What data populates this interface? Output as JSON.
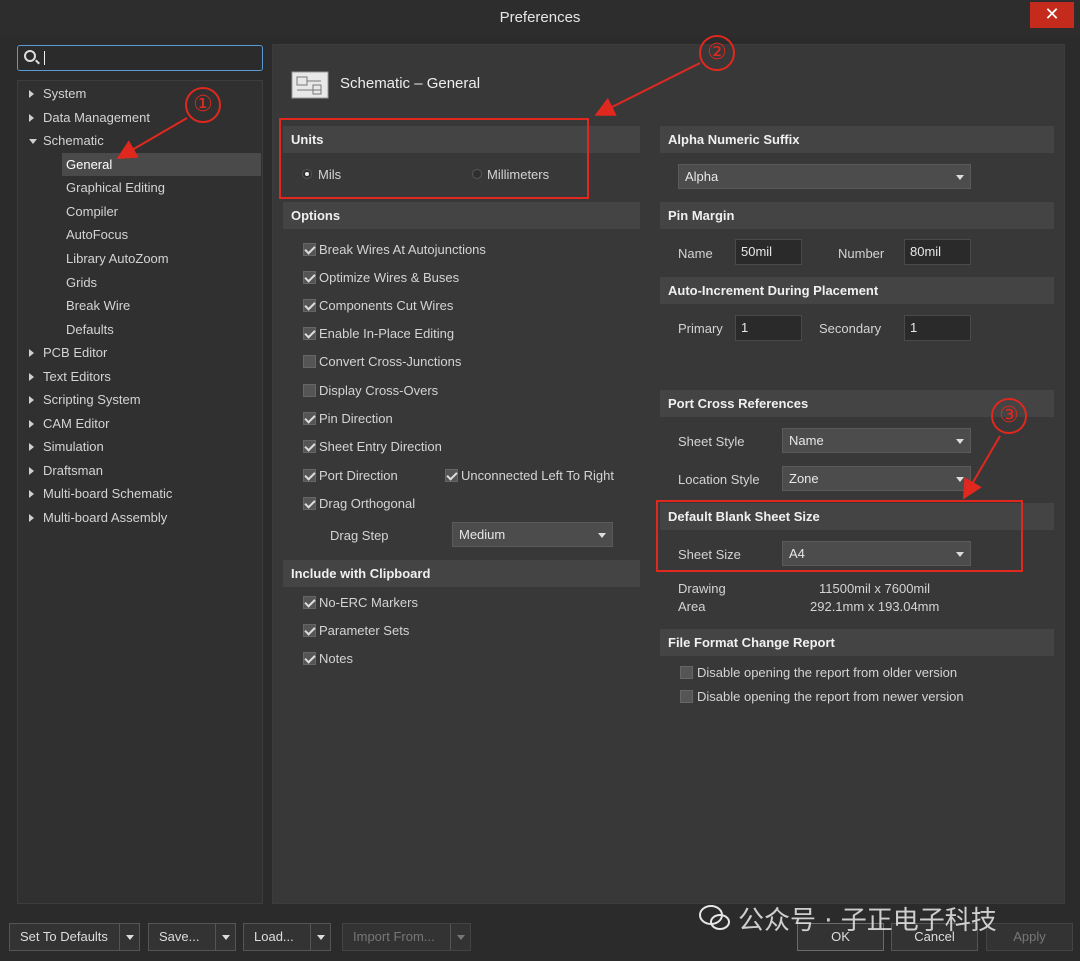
{
  "window": {
    "title": "Preferences",
    "close": "✕"
  },
  "search": {
    "placeholder": ""
  },
  "tree": [
    {
      "label": "System"
    },
    {
      "label": "Data Management"
    },
    {
      "label": "Schematic"
    },
    {
      "label": "General"
    },
    {
      "label": "Graphical Editing"
    },
    {
      "label": "Compiler"
    },
    {
      "label": "AutoFocus"
    },
    {
      "label": "Library AutoZoom"
    },
    {
      "label": "Grids"
    },
    {
      "label": "Break Wire"
    },
    {
      "label": "Defaults"
    },
    {
      "label": "PCB Editor"
    },
    {
      "label": "Text Editors"
    },
    {
      "label": "Scripting System"
    },
    {
      "label": "CAM Editor"
    },
    {
      "label": "Simulation"
    },
    {
      "label": "Draftsman"
    },
    {
      "label": "Multi-board Schematic"
    },
    {
      "label": "Multi-board Assembly"
    }
  ],
  "page": {
    "title": "Schematic – General"
  },
  "units": {
    "header": "Units",
    "mils": "Mils",
    "millimeters": "Millimeters"
  },
  "options": {
    "header": "Options",
    "items": [
      "Break Wires At Autojunctions",
      "Optimize Wires & Buses",
      "Components Cut Wires",
      "Enable In-Place Editing",
      "Convert Cross-Junctions",
      "Display Cross-Overs",
      "Pin Direction",
      "Sheet Entry Direction",
      "Port Direction",
      "Drag Orthogonal"
    ],
    "unconnected": "Unconnected Left To Right",
    "drag_step_label": "Drag Step",
    "drag_step_value": "Medium"
  },
  "clipboard": {
    "header": "Include with Clipboard",
    "items": [
      "No-ERC Markers",
      "Parameter Sets",
      "Notes"
    ]
  },
  "alpha": {
    "header": "Alpha Numeric Suffix",
    "value": "Alpha"
  },
  "pin_margin": {
    "header": "Pin Margin",
    "name_label": "Name",
    "name_value": "50mil",
    "number_label": "Number",
    "number_value": "80mil"
  },
  "auto_inc": {
    "header": "Auto-Increment During Placement",
    "primary_label": "Primary",
    "primary_value": "1",
    "secondary_label": "Secondary",
    "secondary_value": "1"
  },
  "port_cross": {
    "header": "Port Cross References",
    "sheet_style_label": "Sheet Style",
    "sheet_style_value": "Name",
    "location_style_label": "Location Style",
    "location_style_value": "Zone"
  },
  "sheet_size": {
    "header": "Default Blank Sheet Size",
    "label": "Sheet Size",
    "value": "A4",
    "drawing_label": "Drawing",
    "area_label": "Area",
    "mil_dims": "11500mil x 7600mil",
    "mm_dims": "292.1mm x 193.04mm"
  },
  "ffcr": {
    "header": "File Format Change Report",
    "older": "Disable opening the report from older version",
    "newer": "Disable opening the report from newer version"
  },
  "buttons": {
    "defaults": "Set To Defaults",
    "save": "Save...",
    "load": "Load...",
    "import": "Import From...",
    "ok": "OK",
    "cancel": "Cancel",
    "apply": "Apply"
  },
  "annotations": [
    "①",
    "②",
    "③"
  ],
  "watermark": "公众号 · 子正电子科技"
}
